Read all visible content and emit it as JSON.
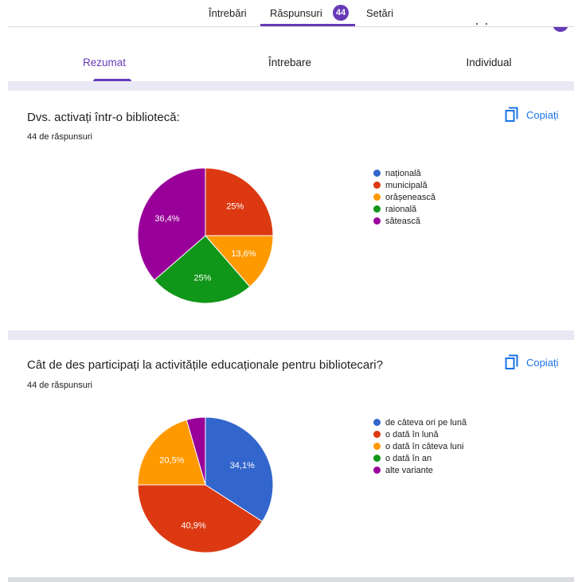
{
  "header": {
    "tabs": [
      {
        "label": "Întrebări"
      },
      {
        "label": "Răspunsuri",
        "badge": "44"
      },
      {
        "label": "Setări"
      }
    ],
    "accent_color": "#673ab7"
  },
  "sub_tabs": [
    {
      "label": "Rezumat"
    },
    {
      "label": "Întrebare"
    },
    {
      "label": "Individual"
    }
  ],
  "copy_label": "Copiați",
  "questions": [
    {
      "title": "Dvs. activați într-o bibliotecă:",
      "responses": "44 de răspunsuri",
      "chart_data": {
        "type": "pie",
        "legend_position": "right",
        "slices": [
          {
            "label": "națională",
            "value": 0,
            "percent_label": "",
            "color": "#3366cc"
          },
          {
            "label": "municipală",
            "value": 25,
            "percent_label": "25%",
            "color": "#dc3912"
          },
          {
            "label": "orășenească",
            "value": 13.6,
            "percent_label": "13,6%",
            "color": "#ff9900"
          },
          {
            "label": "raională",
            "value": 25,
            "percent_label": "25%",
            "color": "#109618"
          },
          {
            "label": "sătească",
            "value": 36.4,
            "percent_label": "36,4%",
            "color": "#990099"
          }
        ]
      }
    },
    {
      "title": "Cât de des participați la activitățile educaționale pentru bibliotecari?",
      "responses": "44 de răspunsuri",
      "chart_data": {
        "type": "pie",
        "legend_position": "right",
        "slices": [
          {
            "label": "de câteva ori pe lună",
            "value": 34.1,
            "percent_label": "34,1%",
            "color": "#3366cc"
          },
          {
            "label": "o dată în lună",
            "value": 40.9,
            "percent_label": "40,9%",
            "color": "#dc3912"
          },
          {
            "label": "o dată în câteva luni",
            "value": 20.5,
            "percent_label": "20,5%",
            "color": "#ff9900"
          },
          {
            "label": "o dată în an",
            "value": 0,
            "percent_label": "",
            "color": "#109618"
          },
          {
            "label": "alte variante",
            "value": 4.5,
            "percent_label": "",
            "color": "#990099"
          }
        ]
      }
    }
  ]
}
